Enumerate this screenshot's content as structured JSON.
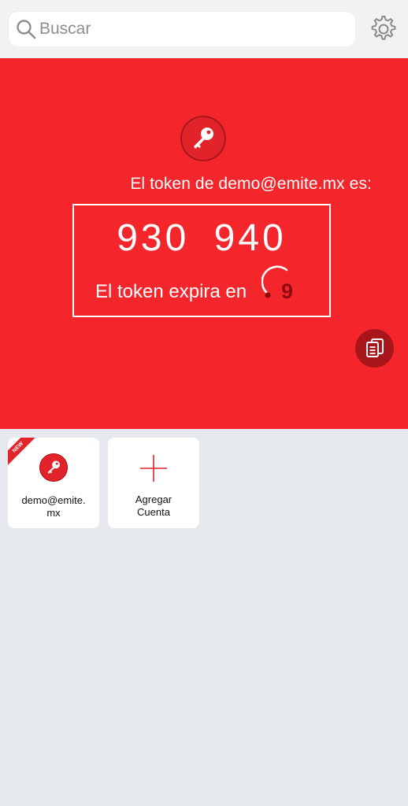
{
  "search": {
    "placeholder": "Buscar",
    "value": ""
  },
  "icons": {
    "search": "search-icon",
    "settings": "gear-icon",
    "key": "key-icon",
    "copy": "copy-icon",
    "add": "plus-icon"
  },
  "token": {
    "title": "El token de demo@emite.mx es:",
    "code": "930 940",
    "expires_label": "El token expira en",
    "seconds_left": "9"
  },
  "accounts": [
    {
      "badge": "NEW",
      "label_line1": "demo@emite.",
      "label_line2": "mx"
    }
  ],
  "add_card": {
    "label_line1": "Agregar",
    "label_line2": "Cuenta"
  },
  "colors": {
    "accent": "#f4262c",
    "dark_accent": "#a8161b",
    "background": "#e6e9ed",
    "timer_text": "#8c0c0f"
  }
}
